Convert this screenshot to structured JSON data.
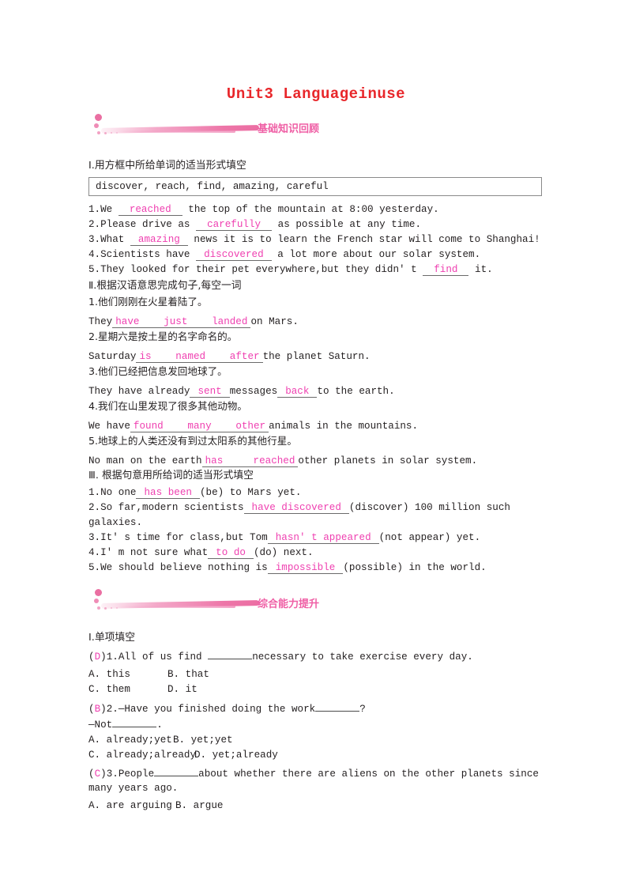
{
  "document": {
    "title": "Unit3  Languageinuse",
    "title_color": "#e8262a",
    "answer_color": "#ef3fb0",
    "banner_color": "#ef5fa5"
  },
  "banners": [
    {
      "label": "基础知识回顾"
    },
    {
      "label": "综合能力提升"
    }
  ],
  "section_1": {
    "heading": "Ⅰ.用方框中所给单词的适当形式填空",
    "word_box": "discover, reach, find, amazing, careful",
    "items": [
      {
        "num": "1.",
        "pre": "We",
        "answer": "reached",
        "post": "the top of the mountain at 8:00 yesterday."
      },
      {
        "num": "2.",
        "pre": "Please drive as",
        "answer": "carefully",
        "post": "as possible at any time."
      },
      {
        "num": "3.",
        "pre": "What",
        "answer": "amazing",
        "post": "news it is to learn the French star will come to Shanghai!"
      },
      {
        "num": "4.",
        "pre": "Scientists have",
        "answer": "discovered",
        "post": "a lot more about our solar system."
      },
      {
        "num": "5.",
        "pre": "They looked for their pet everywhere,but they didn' t",
        "answer": "find",
        "post": "it."
      }
    ]
  },
  "section_2": {
    "heading": "Ⅱ.根据汉语意思完成句子,每空一词",
    "items": [
      {
        "num": "1.",
        "chinese": "他们刚刚在火星着陆了。",
        "pre": "They",
        "answers": [
          "have",
          "just",
          "landed"
        ],
        "post": "on Mars."
      },
      {
        "num": "2.",
        "chinese": "星期六是按土星的名字命名的。",
        "pre": "Saturday",
        "answers": [
          "is",
          "named",
          "after"
        ],
        "post": "the planet Saturn."
      },
      {
        "num": "3.",
        "chinese": "他们已经把信息发回地球了。",
        "pre": "They have already",
        "answers": [
          "sent"
        ],
        "mid": "messages",
        "answers2": [
          "back"
        ],
        "post": "to the earth."
      },
      {
        "num": "4.",
        "chinese": "我们在山里发现了很多其他动物。",
        "pre": "We have",
        "answers": [
          "found",
          "many",
          "other"
        ],
        "post": "animals in the mountains."
      },
      {
        "num": "5.",
        "chinese": "地球上的人类还没有到过太阳系的其他行星。",
        "pre": "No man on the earth",
        "answers": [
          "has",
          "reached"
        ],
        "post": "other planets in solar system."
      }
    ]
  },
  "section_3": {
    "heading": "Ⅲ. 根据句意用所给词的适当形式填空",
    "items": [
      {
        "num": "1.",
        "pre": "No one",
        "answer": "has been",
        "post": "(be) to Mars yet."
      },
      {
        "num": "2.",
        "pre": "So far,modern scientists",
        "answer": "have discovered",
        "post": "(discover) 100 million such",
        "cont": "galaxies."
      },
      {
        "num": "3.",
        "pre": "It' s time for class,but Tom",
        "answer": "hasn' t appeared",
        "post": "(not appear) yet."
      },
      {
        "num": "4.",
        "pre": "I' m not sure what",
        "answer": "to do",
        "post": "(do) next."
      },
      {
        "num": "5.",
        "pre": "We should believe nothing is",
        "answer": "impossible",
        "post": "(possible) in the world."
      }
    ]
  },
  "section_4": {
    "heading": "Ⅰ.单项填空",
    "questions": [
      {
        "answer": "D",
        "num": "1.",
        "stem_pre": "All of us find",
        "stem_post": "necessary to take exercise every day.",
        "options_rows": [
          {
            "a": "A. this",
            "b": "B. that"
          },
          {
            "a": "C. them",
            "b": "D. it"
          }
        ]
      },
      {
        "answer": "B",
        "num": "2.",
        "stem_pre": "—Have you finished doing the work",
        "stem_post": "?",
        "stem_line2_pre": "—Not",
        "stem_line2_post": ".",
        "options_rows": [
          {
            "a": "A. already;yet",
            "b": "B. yet;yet"
          },
          {
            "a": "C. already;already",
            "b": "D. yet;already"
          }
        ]
      },
      {
        "answer": "C",
        "num": "3.",
        "stem_pre": "People",
        "stem_post": "about whether there are aliens on the other planets since",
        "stem_cont": "many years ago.",
        "options_rows": [
          {
            "a": "A. are arguing",
            "b": "B. argue"
          }
        ]
      }
    ]
  }
}
